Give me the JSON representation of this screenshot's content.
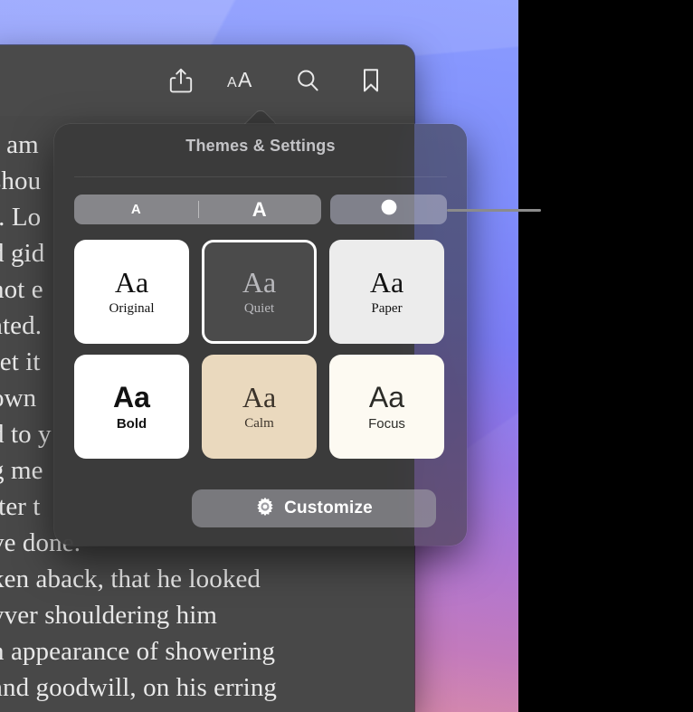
{
  "window": {
    "toolbar": {
      "buttons": [
        {
          "name": "share-icon",
          "label": "Share"
        },
        {
          "name": "text-size-icon",
          "label": "AA"
        },
        {
          "name": "search-icon",
          "label": "Search"
        },
        {
          "name": "bookmark-icon",
          "label": "Bookmark"
        }
      ]
    },
    "reader_text_lines": [
      "I am",
      "shou",
      "r. Lo",
      "d gid",
      "not e",
      "ated.",
      "ret it",
      " own",
      "d to y",
      "g me",
      "tter t",
      "ve done.",
      "ken aback, that he looked",
      "yver shouldering him",
      "n appearance of showering",
      "and goodwill, on his erring"
    ]
  },
  "popover": {
    "title": "Themes & Settings",
    "size_control": {
      "small_label": "A",
      "large_label": "A"
    },
    "appearance_toggle": {
      "icon": "appearance-circle-icon"
    },
    "themes": [
      {
        "key": "original",
        "aa": "Aa",
        "name": "Original",
        "bg": "#FFFFFF",
        "fg": "#111111",
        "font": "serif",
        "weight": "normal",
        "selected": false
      },
      {
        "key": "quiet",
        "aa": "Aa",
        "name": "Quiet",
        "bg": "#4B4B4B",
        "fg": "#B9B9BD",
        "font": "serif",
        "weight": "normal",
        "selected": true
      },
      {
        "key": "paper",
        "aa": "Aa",
        "name": "Paper",
        "bg": "#ECECEC",
        "fg": "#121212",
        "font": "serif",
        "weight": "normal",
        "selected": false
      },
      {
        "key": "bold",
        "aa": "Aa",
        "name": "Bold",
        "bg": "#FFFFFF",
        "fg": "#121212",
        "font": "sans",
        "weight": "bold",
        "selected": false
      },
      {
        "key": "calm",
        "aa": "Aa",
        "name": "Calm",
        "bg": "#EAD9BE",
        "fg": "#3B332A",
        "font": "serif",
        "weight": "normal",
        "selected": false
      },
      {
        "key": "focus",
        "aa": "Aa",
        "name": "Focus",
        "bg": "#FDFAF2",
        "fg": "#2C2C28",
        "font": "sans",
        "weight": "normal",
        "selected": false
      }
    ],
    "customize": {
      "label": "Customize",
      "icon": "gear-icon"
    }
  },
  "colors": {
    "popover_bg": "#3A3A3A",
    "window_bg": "#484848",
    "toolbar_bg": "#4A4A4A",
    "accent_selected": "#FFFFFF",
    "callout_line": "#8B8B8B"
  }
}
